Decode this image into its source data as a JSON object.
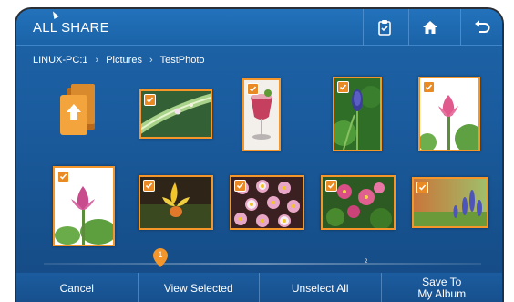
{
  "app": {
    "title": "ALL SHARE"
  },
  "breadcrumb": [
    "LINUX-PC:1",
    "Pictures",
    "TestPhoto"
  ],
  "toolbar": {
    "clip_icon": "clipboard-icon",
    "home_icon": "home-icon",
    "back_icon": "back-arrow-icon"
  },
  "photos": [
    {
      "subject": "raindrop-leaf",
      "selected": true
    },
    {
      "subject": "pink-drink",
      "selected": true
    },
    {
      "subject": "grape-hyacinth",
      "selected": true
    },
    {
      "subject": "pink-lotus",
      "selected": true
    },
    {
      "subject": "pink-lotus-leaves",
      "selected": true
    },
    {
      "subject": "yellow-orchid",
      "selected": true
    },
    {
      "subject": "daisy-field",
      "selected": true
    },
    {
      "subject": "pink-dahlias",
      "selected": true
    },
    {
      "subject": "lavender-field",
      "selected": true
    }
  ],
  "pager": {
    "current": "1",
    "total": "2"
  },
  "actions": {
    "cancel": "Cancel",
    "view_selected": "View Selected",
    "unselect_all": "Unselect All",
    "save_line1": "Save To",
    "save_line2": "My Album"
  },
  "colors": {
    "accent": "#f5962a",
    "background": "#1a5b9d"
  }
}
